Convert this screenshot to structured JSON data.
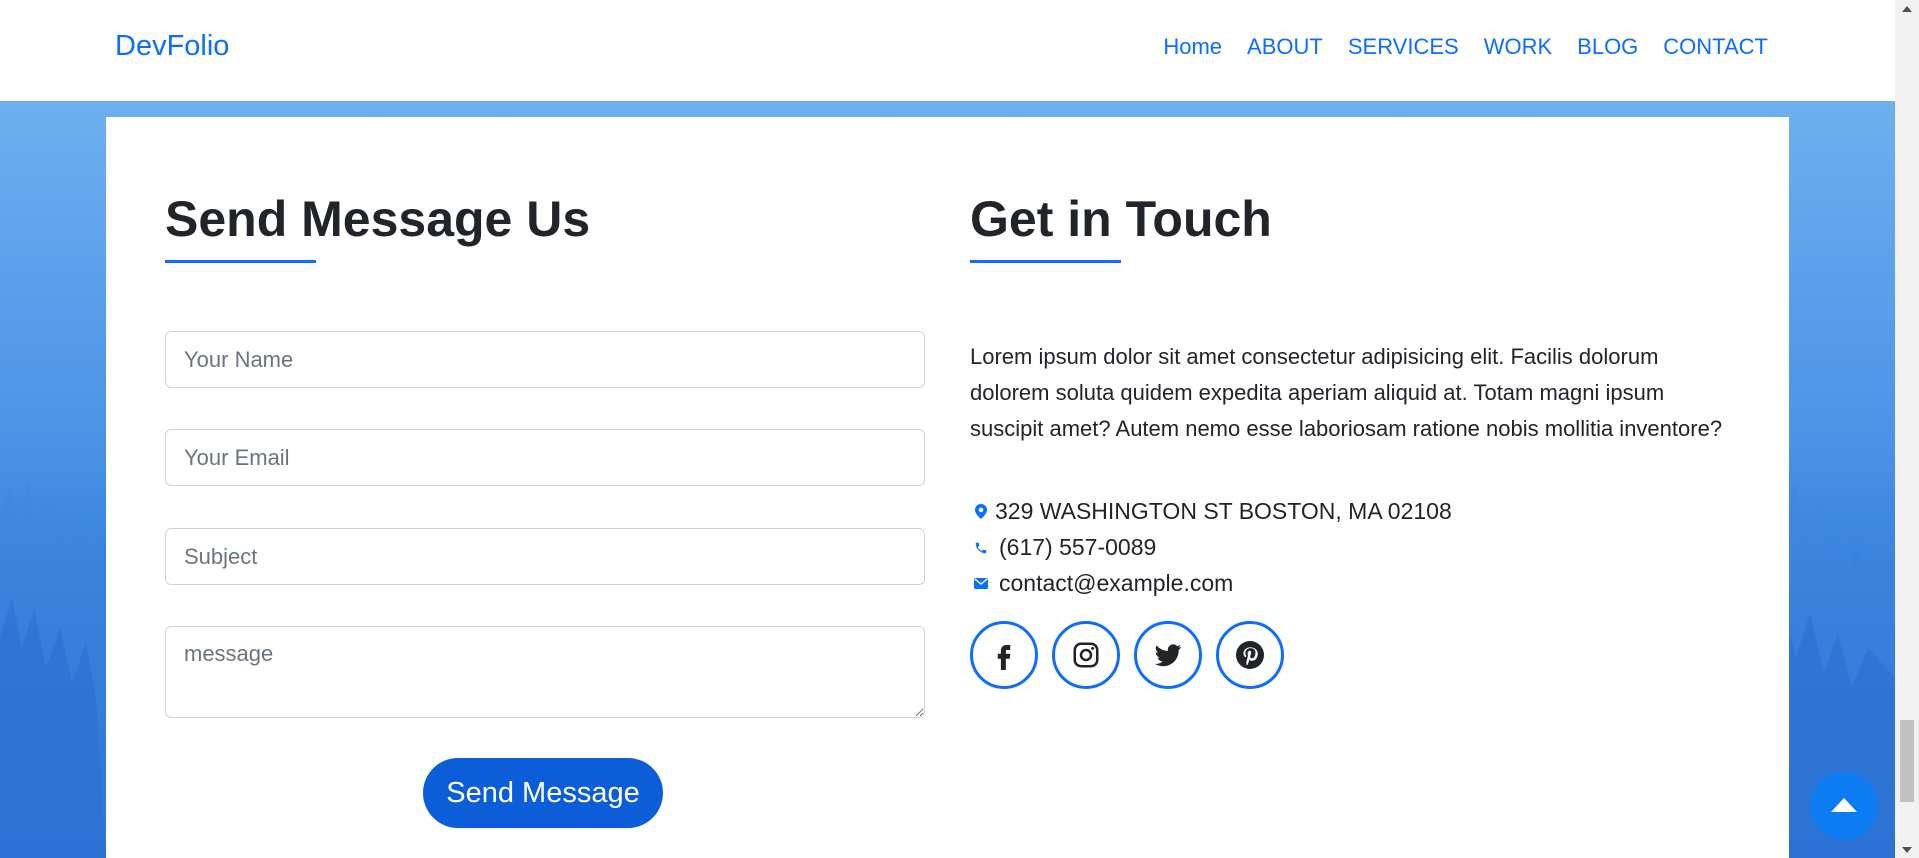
{
  "brand": "DevFolio",
  "nav": [
    "Home",
    "ABOUT",
    "SERVICES",
    "WORK",
    "BLOG",
    "CONTACT"
  ],
  "form": {
    "title": "Send Message Us",
    "name_placeholder": "Your Name",
    "email_placeholder": "Your Email",
    "subject_placeholder": "Subject",
    "message_placeholder": "message",
    "submit_label": "Send Message"
  },
  "contact": {
    "title": "Get in Touch",
    "description": "Lorem ipsum dolor sit amet consectetur adipisicing elit. Facilis dolorum dolorem soluta quidem expedita aperiam aliquid at. Totam magni ipsum suscipit amet? Autem nemo esse laboriosam ratione nobis mollitia inventore?",
    "address": "329 WASHINGTON ST BOSTON, MA 02108",
    "phone": "(617) 557-0089",
    "email": "contact@example.com",
    "socials": [
      "facebook-icon",
      "instagram-icon",
      "twitter-icon",
      "pinterest-icon"
    ]
  },
  "colors": {
    "primary": "#0d6efd",
    "button": "#0b5ed7",
    "background_blue": "#2c78da"
  }
}
